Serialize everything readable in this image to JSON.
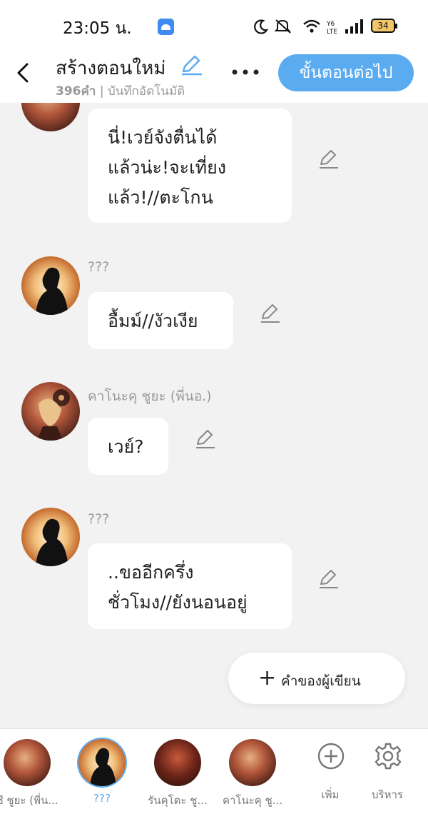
{
  "status": {
    "time": "23:05 น.",
    "battery": "34",
    "icons": "☾ 🔕 ⌇ ıll"
  },
  "header": {
    "title": "สร้างตอนใหม่",
    "word_count": "396คำ",
    "autosave": "| บันทึกอัตโนมัติ",
    "next_label": "ขั้นตอนต่อไป"
  },
  "messages": [
    {
      "speaker": "",
      "avatar": "char",
      "text": "นี่!เวย์จังตื่นได้\nแล้วน่ะ!จะเที่ยง\nแล้ว!//ตะโกน"
    },
    {
      "speaker": "???",
      "avatar": "silhouette",
      "text": "อื้มม์//งัวเงีย"
    },
    {
      "speaker": "คาโนะคุ ชูยะ (พี่นอ.)",
      "avatar": "char",
      "text": "เวย์?"
    },
    {
      "speaker": "???",
      "avatar": "silhouette",
      "text": "..ขออีกครึ่ง\nชั่วโมง//ยังนอนอยู่"
    }
  ],
  "author_button": {
    "label": "คำของผู้เขียน"
  },
  "bottom_bar": {
    "characters": [
      {
        "label": "ชี ชูยะ (พี่น...",
        "avatar": "char",
        "selected": false
      },
      {
        "label": "???",
        "avatar": "silhouette",
        "selected": true
      },
      {
        "label": "รันคุโตะ ชู...",
        "avatar": "dark",
        "selected": false
      },
      {
        "label": "คาโนะคุ ชู...",
        "avatar": "char",
        "selected": false
      }
    ],
    "add_label": "เพิ่ม",
    "manage_label": "บริหาร"
  },
  "colors": {
    "accent": "#5aabf0",
    "background": "#f2f2f2",
    "bubble": "#ffffff"
  }
}
